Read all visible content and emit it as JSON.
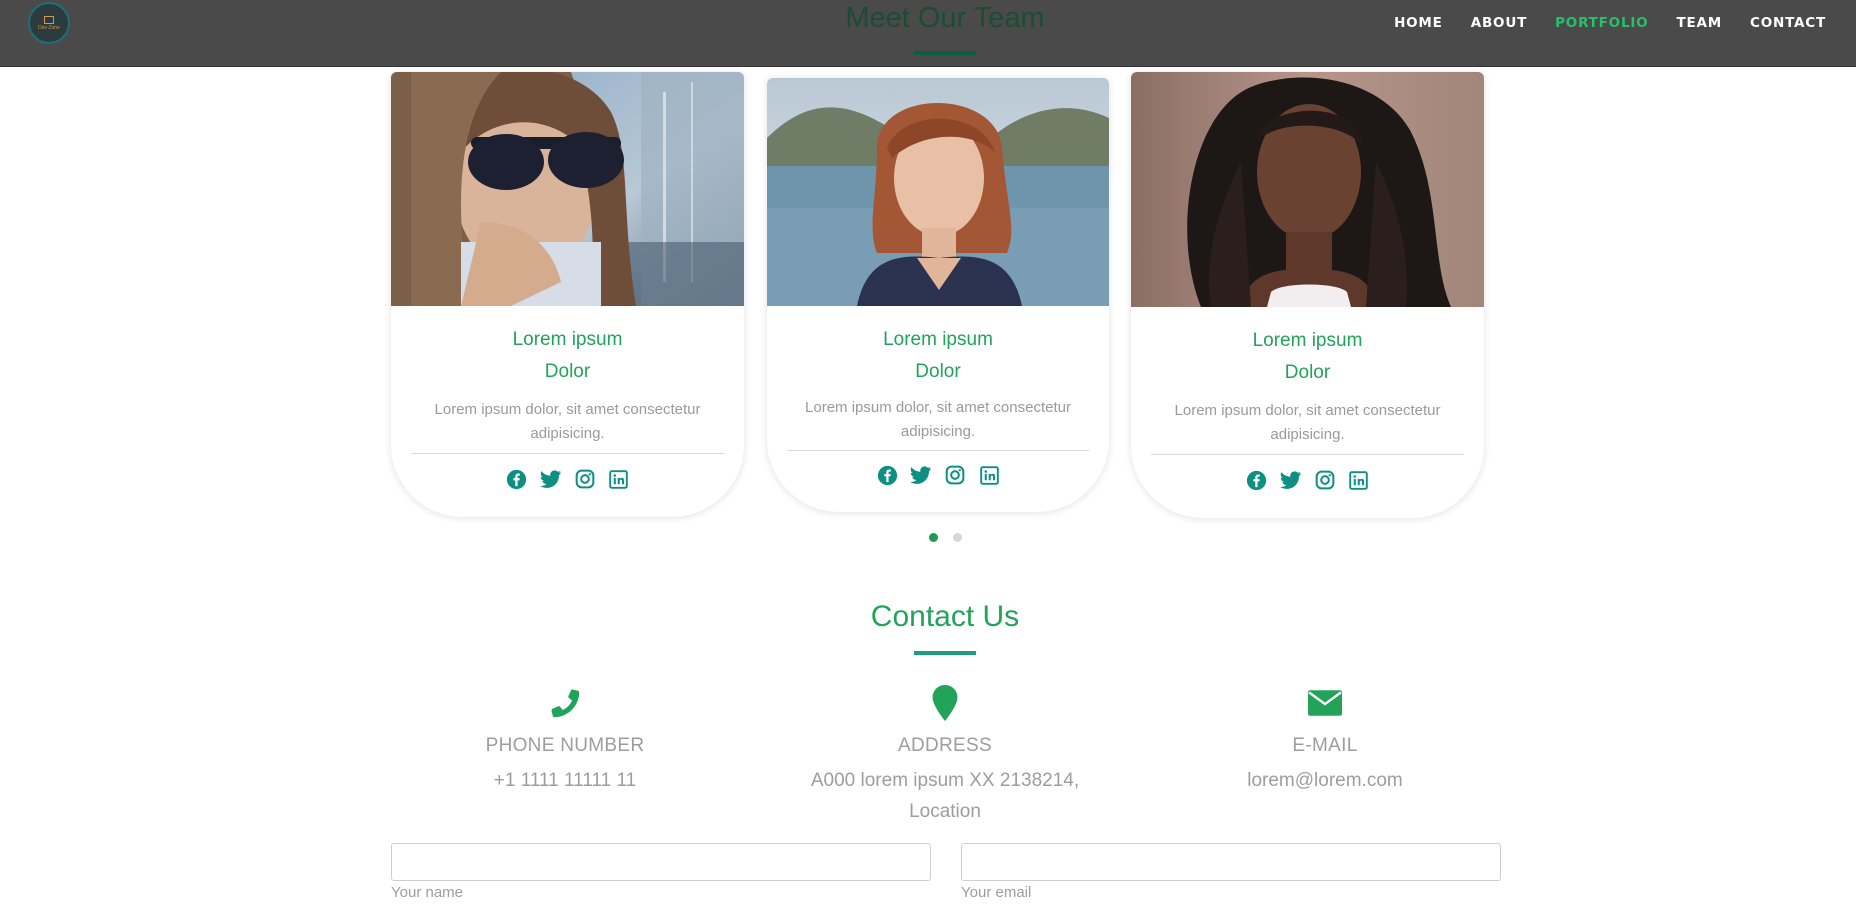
{
  "nav": {
    "logo": {
      "text": "Dev Zone"
    },
    "links": [
      "HOME",
      "ABOUT",
      "PORTFOLIO",
      "TEAM",
      "CONTACT"
    ],
    "active_index": 2,
    "active_color": "#27c06b"
  },
  "team": {
    "title": "Meet Our Team",
    "cards": [
      {
        "name_line1": "Lorem ipsum",
        "name_line2": "Dolor",
        "description": "Lorem ipsum dolor, sit amet consectetur adipisicing.",
        "social": [
          "facebook-icon",
          "twitter-icon",
          "instagram-icon",
          "linkedin-icon"
        ]
      },
      {
        "name_line1": "Lorem ipsum",
        "name_line2": "Dolor",
        "description": "Lorem ipsum dolor, sit amet consectetur adipisicing.",
        "social": [
          "facebook-icon",
          "twitter-icon",
          "instagram-icon",
          "linkedin-icon"
        ]
      },
      {
        "name_line1": "Lorem ipsum",
        "name_line2": "Dolor",
        "description": "Lorem ipsum dolor, sit amet consectetur adipisicing.",
        "social": [
          "facebook-icon",
          "twitter-icon",
          "instagram-icon",
          "linkedin-icon"
        ]
      }
    ],
    "carousel": {
      "pages": 2,
      "active_page": 1
    }
  },
  "contact": {
    "title": "Contact Us",
    "items": [
      {
        "icon": "phone-icon",
        "label": "PHONE NUMBER",
        "value": "+1 1111 11111 11"
      },
      {
        "icon": "map-marker-icon",
        "label": "ADDRESS",
        "value": "A000 lorem ipsum XX 2138214, Location"
      },
      {
        "icon": "envelope-icon",
        "label": "E-MAIL",
        "value": "lorem@lorem.com"
      }
    ],
    "form": {
      "name_value": "",
      "name_label": "Your name",
      "email_value": "",
      "email_label": "Your email"
    }
  },
  "colors": {
    "brand_green": "#22a35a",
    "icon_teal": "#0d8f84",
    "nav_bg": "#4a4a4a"
  }
}
